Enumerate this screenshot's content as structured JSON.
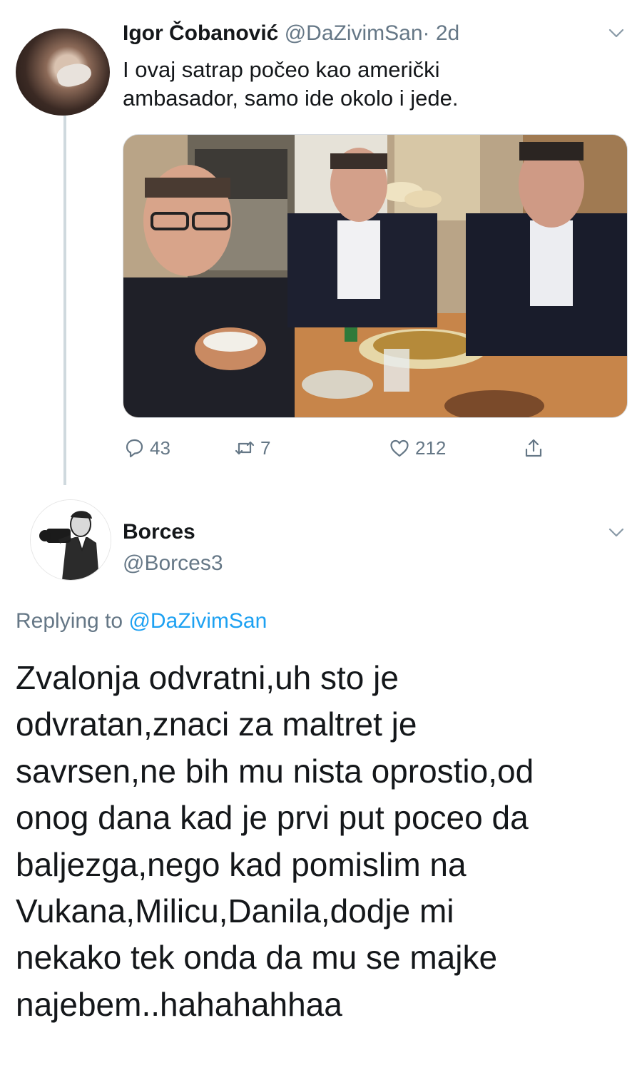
{
  "colors": {
    "text_primary": "#14171a",
    "text_secondary": "#657786",
    "link": "#1da1f2",
    "thread_line": "#cfd9de"
  },
  "tweet": {
    "author_name": "Igor Čobanović",
    "author_handle": "@DaZivimSan",
    "age": "· 2d",
    "text_lines": [
      "I ovaj satrap počeo kao američki",
      "ambasador, samo ide okolo i jede."
    ],
    "menu_icon": "chevron-down-icon",
    "actions": {
      "reply_count": "43",
      "retweet_count": "7",
      "like_count": "212",
      "reply_icon": "comment-icon",
      "retweet_icon": "retweet-icon",
      "like_icon": "heart-icon",
      "share_icon": "share-icon"
    }
  },
  "reply": {
    "author_name": "Borces",
    "author_handle": "@Borces3",
    "menu_icon": "chevron-down-icon",
    "replying_prefix": "Replying to",
    "replying_handle": "@DaZivimSan",
    "text_lines": [
      "Zvalonja odvratni,uh sto je",
      "odvratan,znaci za maltret je",
      "savrsen,ne bih mu nista oprostio,od",
      "onog dana kad je prvi put poceo da",
      "baljezga,nego kad pomislim na",
      "Vukana,Milicu,Danila,dodje mi",
      "nekako tek onda da mu se majke",
      "najebem..hahahahhaa"
    ]
  }
}
